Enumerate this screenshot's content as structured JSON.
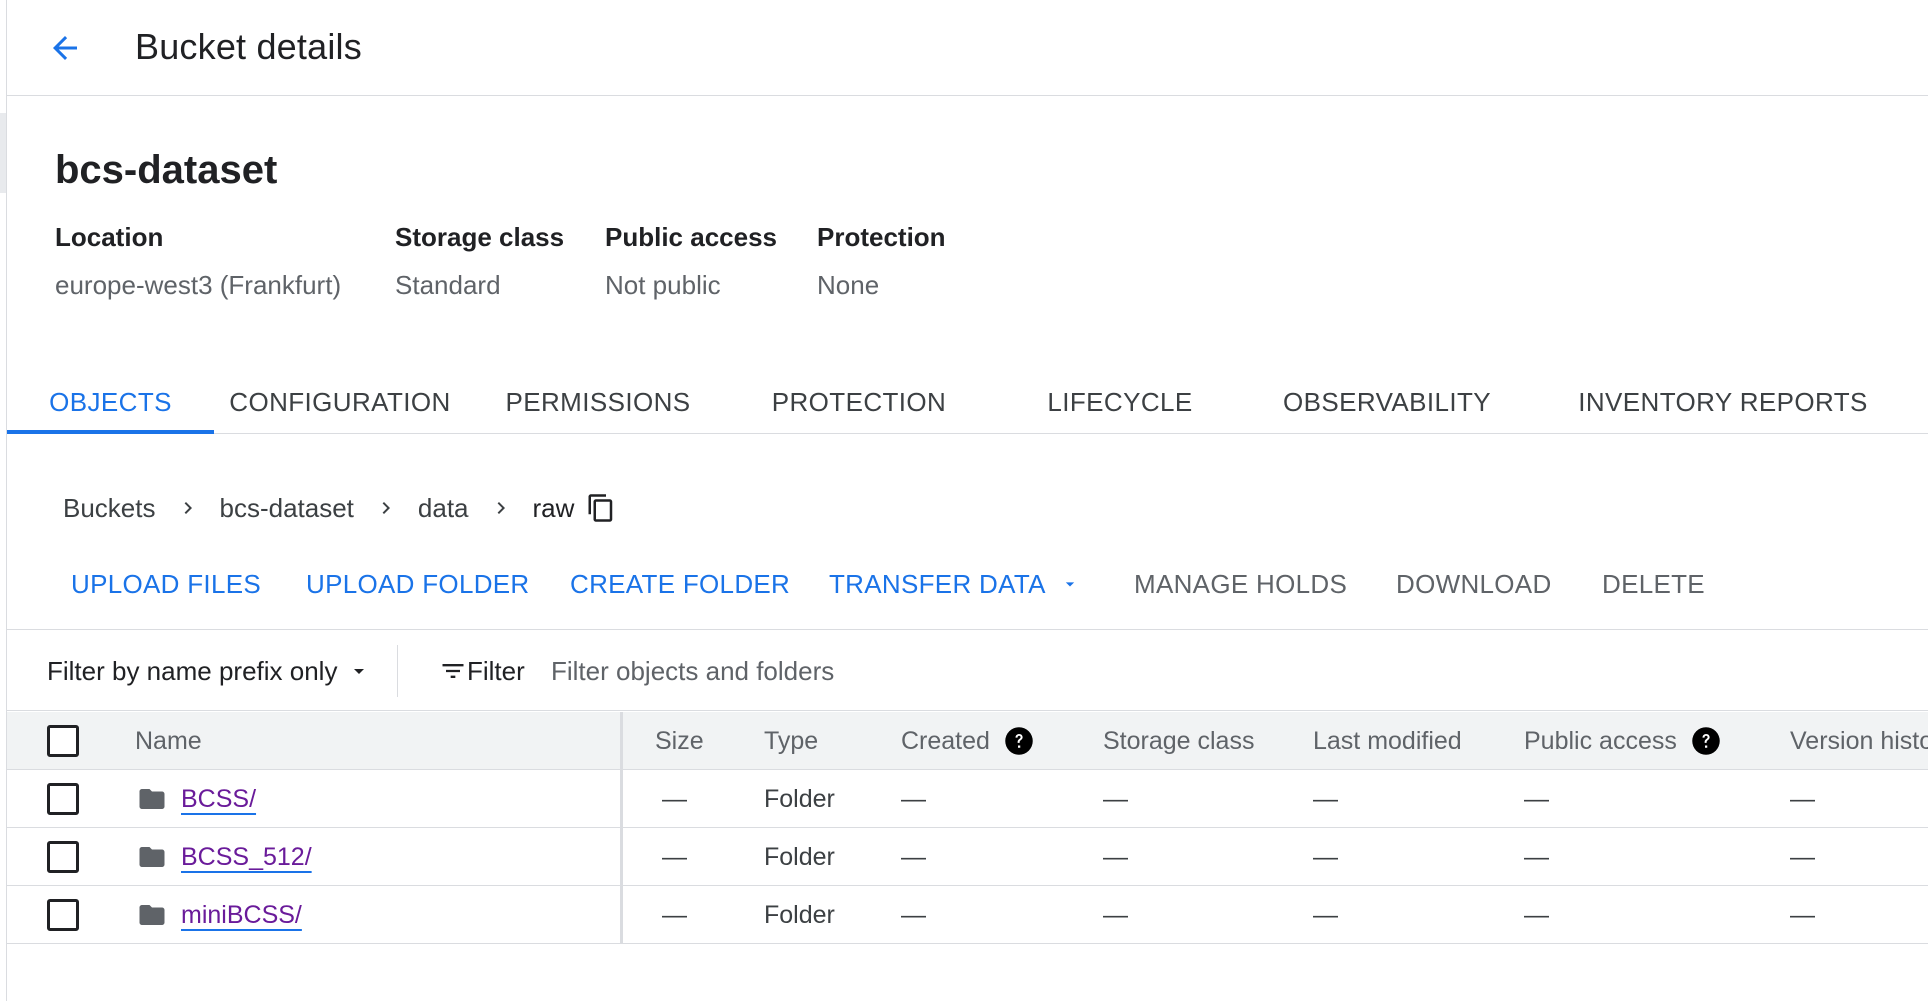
{
  "header": {
    "title": "Bucket details",
    "back_icon": "arrow-back-icon"
  },
  "bucket": {
    "name": "bcs-dataset",
    "meta": [
      {
        "label": "Location",
        "value": "europe-west3 (Frankfurt)"
      },
      {
        "label": "Storage class",
        "value": "Standard"
      },
      {
        "label": "Public access",
        "value": "Not public"
      },
      {
        "label": "Protection",
        "value": "None"
      }
    ]
  },
  "tabs": [
    {
      "label": "OBJECTS",
      "active": true
    },
    {
      "label": "CONFIGURATION"
    },
    {
      "label": "PERMISSIONS"
    },
    {
      "label": "PROTECTION"
    },
    {
      "label": "LIFECYCLE"
    },
    {
      "label": "OBSERVABILITY"
    },
    {
      "label": "INVENTORY REPORTS"
    }
  ],
  "breadcrumb": {
    "items": [
      "Buckets",
      "bcs-dataset",
      "data",
      "raw"
    ],
    "copy_icon": "copy-icon"
  },
  "actions": {
    "upload_files": "UPLOAD FILES",
    "upload_folder": "UPLOAD FOLDER",
    "create_folder": "CREATE FOLDER",
    "transfer_data": "TRANSFER DATA",
    "manage_holds": "MANAGE HOLDS",
    "download": "DOWNLOAD",
    "delete": "DELETE"
  },
  "filter": {
    "mode": "Filter by name prefix only",
    "button_label": "Filter",
    "placeholder": "Filter objects and folders"
  },
  "table": {
    "columns": {
      "name": "Name",
      "size": "Size",
      "type": "Type",
      "created": "Created",
      "storage_class": "Storage class",
      "last_modified": "Last modified",
      "public_access": "Public access",
      "version_history": "Version histo"
    },
    "rows": [
      {
        "name": "BCSS/",
        "size": "—",
        "type": "Folder",
        "created": "—",
        "storage_class": "—",
        "last_modified": "—",
        "public_access": "—",
        "version_history": "—"
      },
      {
        "name": "BCSS_512/",
        "size": "—",
        "type": "Folder",
        "created": "—",
        "storage_class": "—",
        "last_modified": "—",
        "public_access": "—",
        "version_history": "—"
      },
      {
        "name": "miniBCSS/",
        "size": "—",
        "type": "Folder",
        "created": "—",
        "storage_class": "—",
        "last_modified": "—",
        "public_access": "—",
        "version_history": "—"
      }
    ]
  },
  "colors": {
    "accent": "#1a73e8",
    "link_visited": "#6a1b9a",
    "text_primary": "#202124",
    "text_secondary": "#5f6368",
    "divider": "#dadce0"
  }
}
